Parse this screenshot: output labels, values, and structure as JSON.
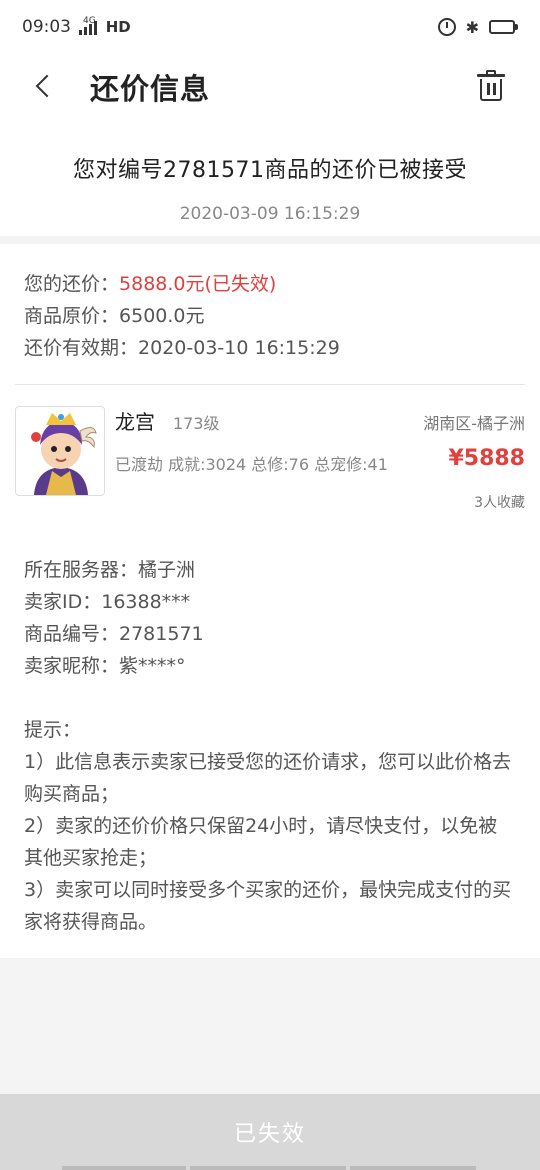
{
  "status_bar": {
    "time": "09:03",
    "network": "4G",
    "hd_label": "HD",
    "battery_level": 0.45
  },
  "nav": {
    "title": "还价信息"
  },
  "header": {
    "headline": "您对编号2781571商品的还价已被接受",
    "time": "2020-03-09 16:15:29"
  },
  "offer": {
    "your_offer_label": "您的还价：",
    "your_offer_value": "5888.0元(已失效)",
    "original_price_label": "商品原价：",
    "original_price_value": "6500.0元",
    "validity_label": "还价有效期：",
    "validity_value": "2020-03-10 16:15:29"
  },
  "goods": {
    "avatar_icon": "character-avatar-icon",
    "name": "龙宫",
    "level": "173级",
    "region": "湖南区-橘子洲",
    "stats": "已渡劫 成就:3024 总修:76 总宠修:41",
    "price": "¥5888",
    "favorites": "3人收藏"
  },
  "info": {
    "server": "所在服务器：橘子洲",
    "seller_id": "卖家ID：16388***",
    "goods_no": "商品编号：2781571",
    "seller_nick": "卖家昵称：紫****°"
  },
  "tips": {
    "title": "提示：",
    "items": [
      "1）此信息表示卖家已接受您的还价请求，您可以此价格去购买商品；",
      "2）卖家的还价价格只保留24小时，请尽快支付，以免被其他买家抢走；",
      "3）卖家可以同时接受多个买家的还价，最快完成支付的买家将获得商品。"
    ]
  },
  "bottom": {
    "button_label": "已失效"
  },
  "colors": {
    "accent_red": "#e0413c",
    "disabled_button": "#d8d8d8"
  }
}
